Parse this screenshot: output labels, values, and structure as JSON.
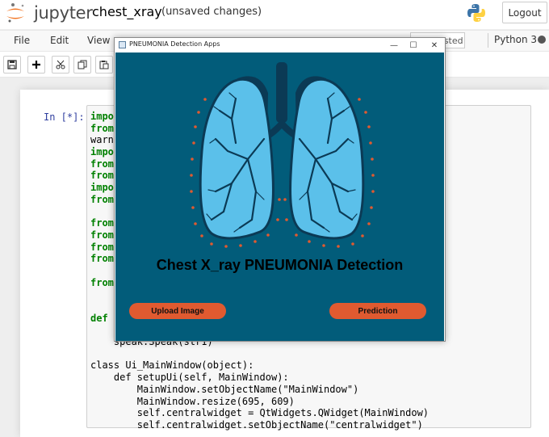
{
  "header": {
    "logo_text": "jupyter",
    "notebook_name": "chest_xray",
    "save_status": "(unsaved changes)",
    "logout_label": "Logout"
  },
  "menubar": {
    "items": [
      "File",
      "Edit",
      "View"
    ],
    "trusted_label": "Not Trusted",
    "kernel_name": "Python 3"
  },
  "toolbar": {
    "buttons": [
      "save-icon",
      "plus-icon",
      "scissors-icon",
      "copy-icon",
      "paste-icon"
    ]
  },
  "cell": {
    "prompt": "In [*]:",
    "code_lines_visible": [
      "impo",
      "from",
      "warn",
      "impo",
      "from",
      "from",
      "impo",
      "from",
      "",
      "from",
      "from",
      "from",
      "from",
      "",
      "from",
      "",
      "",
      "def s",
      "    s",
      "    speak.Speak(str1)",
      "",
      "class Ui_MainWindow(object):",
      "    def setupUi(self, MainWindow):",
      "        MainWindow.setObjectName(\"MainWindow\")",
      "        MainWindow.resize(695, 609)",
      "        self.centralwidget = QtWidgets.QWidget(MainWindow)",
      "        self.centralwidget.setObjectName(\"centralwidget\")"
    ]
  },
  "app_window": {
    "title": "PNEUMONIA Detection Apps",
    "heading": "Chest X_ray PNEUMONIA Detection",
    "upload_button": "Upload Image",
    "predict_button": "Prediction",
    "controls": {
      "minimize": "—",
      "maximize": "☐",
      "close": "✕"
    },
    "colors": {
      "background": "#025c7a",
      "lung": "#5bc0ea",
      "trachea": "#0b3a55",
      "button": "#e05a30",
      "dots": "#e05a30"
    }
  }
}
